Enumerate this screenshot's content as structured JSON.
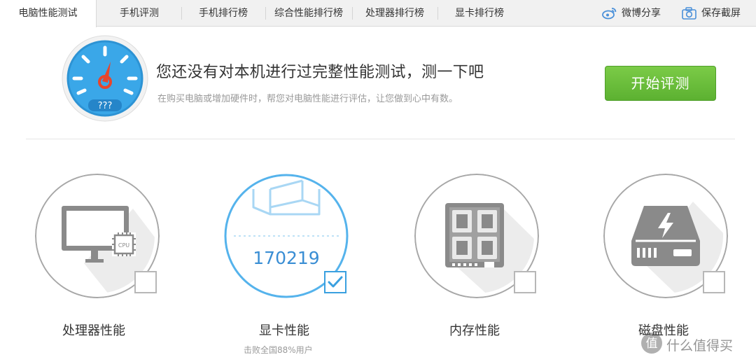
{
  "tabs": [
    {
      "label": "电脑性能测试",
      "active": true
    },
    {
      "label": "手机评测"
    },
    {
      "label": "手机排行榜"
    },
    {
      "label": "综合性能排行榜"
    },
    {
      "label": "处理器排行榜"
    },
    {
      "label": "显卡排行榜"
    }
  ],
  "share": {
    "weibo_label": "微博分享",
    "screenshot_label": "保存截屏"
  },
  "hero": {
    "gauge_text": "???",
    "title": "您还没有对本机进行过完整性能测试，测一下吧",
    "subtitle": "在购买电脑或增加硬件时，帮您对电脑性能进行评估，让您做到心中有数。",
    "start_button": "开始评测"
  },
  "cards": [
    {
      "label": "处理器性能",
      "checked": false,
      "chip_text": "CPU"
    },
    {
      "label": "显卡性能",
      "checked": true,
      "score": "170219",
      "sub": "击败全国88%用户"
    },
    {
      "label": "内存性能",
      "checked": false
    },
    {
      "label": "磁盘性能",
      "checked": false
    }
  ],
  "watermark": "什么值得买",
  "colors": {
    "accent_blue": "#3aa0e0",
    "start_green": "#5cb131",
    "icon_gray": "#8a8a8a"
  }
}
